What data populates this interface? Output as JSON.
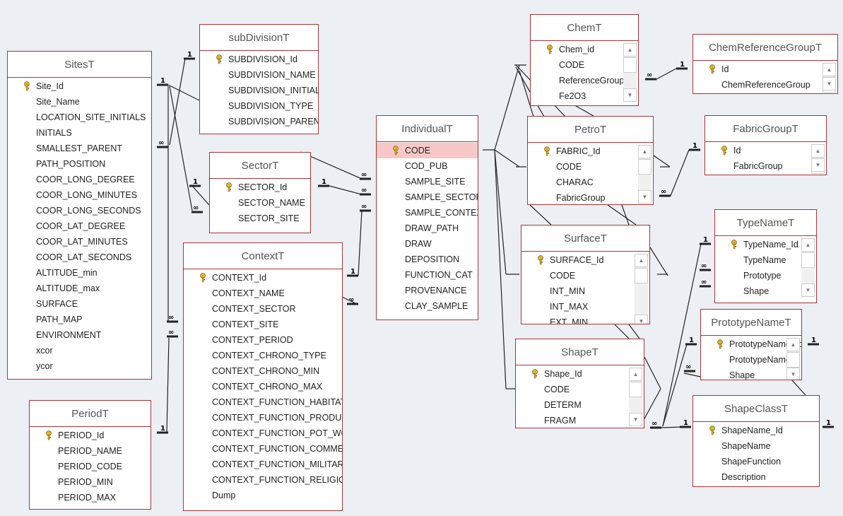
{
  "tables": [
    {
      "name": "SitesT",
      "fields": [
        "Site_Id",
        "Site_Name",
        "LOCATION_SITE_INITIALS",
        "INITIALS",
        "SMALLEST_PARENT",
        "PATH_POSITION",
        "COOR_LONG_DEGREE",
        "COOR_LONG_MINUTES",
        "COOR_LONG_SECONDS",
        "COOR_LAT_DEGREE",
        "COOR_LAT_MINUTES",
        "COOR_LAT_SECONDS",
        "ALTITUDE_min",
        "ALTITUDE_max",
        "SURFACE",
        "PATH_MAP",
        "ENVIRONMENT",
        "xcor",
        "ycor"
      ],
      "scroll": false
    },
    {
      "name": "subDivisionT",
      "fields": [
        "SUBDIVISION_Id",
        "SUBDIVISION_NAME",
        "SUBDIVISION_INITIALS",
        "SUBDIVISION_TYPE",
        "SUBDIVISION_PARENT"
      ],
      "scroll": false
    },
    {
      "name": "SectorT",
      "fields": [
        "SECTOR_Id",
        "SECTOR_NAME",
        "SECTOR_SITE"
      ],
      "scroll": false
    },
    {
      "name": "ContextT",
      "fields": [
        "CONTEXT_Id",
        "CONTEXT_NAME",
        "CONTEXT_SECTOR",
        "CONTEXT_SITE",
        "CONTEXT_PERIOD",
        "CONTEXT_CHRONO_TYPE",
        "CONTEXT_CHRONO_MIN",
        "CONTEXT_CHRONO_MAX",
        "CONTEXT_FUNCTION_HABITATION",
        "CONTEXT_FUNCTION_PRODUCTION",
        "CONTEXT_FUNCTION_POT_WORKSHOP",
        "CONTEXT_FUNCTION_COMMERCIAL",
        "CONTEXT_FUNCTION_MILITARY",
        "CONTEXT_FUNCTION_RELIGIOUS",
        "Dump"
      ],
      "scroll": false
    },
    {
      "name": "PeriodT",
      "fields": [
        "PERIOD_Id",
        "PERIOD_NAME",
        "PERIOD_CODE",
        "PERIOD_MIN",
        "PERIOD_MAX"
      ],
      "scroll": false
    },
    {
      "name": "IndividualT",
      "fields": [
        "CODE",
        "COD_PUB",
        "SAMPLE_SITE",
        "SAMPLE_SECTOR",
        "SAMPLE_CONTEXT",
        "DRAW_PATH",
        "DRAW",
        "DEPOSITION",
        "FUNCTION_CAT",
        "PROVENANCE",
        "CLAY_SAMPLE"
      ],
      "scroll": false,
      "highlighted": "CODE"
    },
    {
      "name": "ChemT",
      "fields": [
        "Chem_id",
        "CODE",
        "ReferenceGroup",
        "Fe2O3"
      ],
      "scroll": true
    },
    {
      "name": "ChemReferenceGroupT",
      "fields": [
        "Id",
        "ChemReferenceGroup"
      ],
      "scroll": true
    },
    {
      "name": "PetroT",
      "fields": [
        "FABRIC_Id",
        "CODE",
        "CHARAC",
        "FabricGroup"
      ],
      "scroll": true
    },
    {
      "name": "FabricGroupT",
      "fields": [
        "Id",
        "FabricGroup"
      ],
      "scroll": true
    },
    {
      "name": "SurfaceT",
      "fields": [
        "SURFACE_Id",
        "CODE",
        "INT_MIN",
        "INT_MAX",
        "EXT_MIN"
      ],
      "scroll": true
    },
    {
      "name": "TypeNameT",
      "fields": [
        "TypeName_Id",
        "TypeName",
        "Prototype",
        "Shape"
      ],
      "scroll": true
    },
    {
      "name": "PrototypeNameT",
      "fields": [
        "PrototypeName_Id",
        "PrototypeName",
        "Shape"
      ],
      "scroll": true
    },
    {
      "name": "ShapeT",
      "fields": [
        "Shape_Id",
        "CODE",
        "DETERM",
        "FRAGM"
      ],
      "scroll": true
    },
    {
      "name": "ShapeClassT",
      "fields": [
        "ShapeName_Id",
        "ShapeName",
        "ShapeFunction",
        "Description"
      ],
      "scroll": false
    }
  ],
  "cardinality": {
    "one": "1",
    "many": "∞"
  },
  "colors": {
    "background": "#eceff3",
    "table_border": "#a4373a",
    "highlight": "#f8c8c8"
  }
}
